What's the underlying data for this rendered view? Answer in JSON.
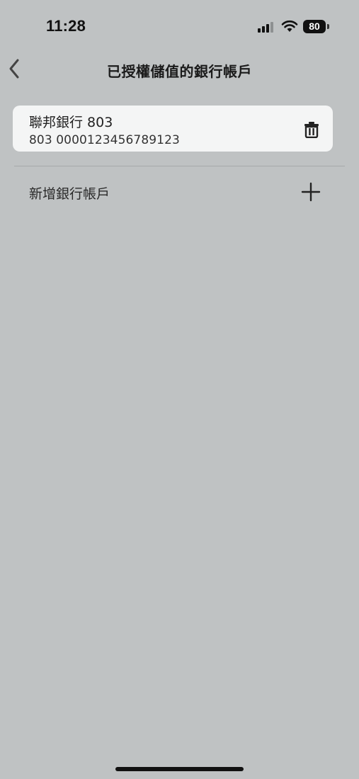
{
  "status_bar": {
    "time": "11:28",
    "battery": "80",
    "icons": [
      "signal-icon",
      "wifi-icon",
      "battery-icon"
    ]
  },
  "nav": {
    "title": "已授權儲值的銀行帳戶",
    "back_icon": "chevron-left-icon"
  },
  "accounts": [
    {
      "name": "聯邦銀行 803",
      "number": "803 0000123456789123",
      "action_icon": "trash-icon"
    }
  ],
  "add_account": {
    "label": "新增銀行帳戶",
    "icon": "plus-icon"
  },
  "colors": {
    "background": "#bfc2c3",
    "card": "#f4f5f5",
    "text": "#222222"
  }
}
